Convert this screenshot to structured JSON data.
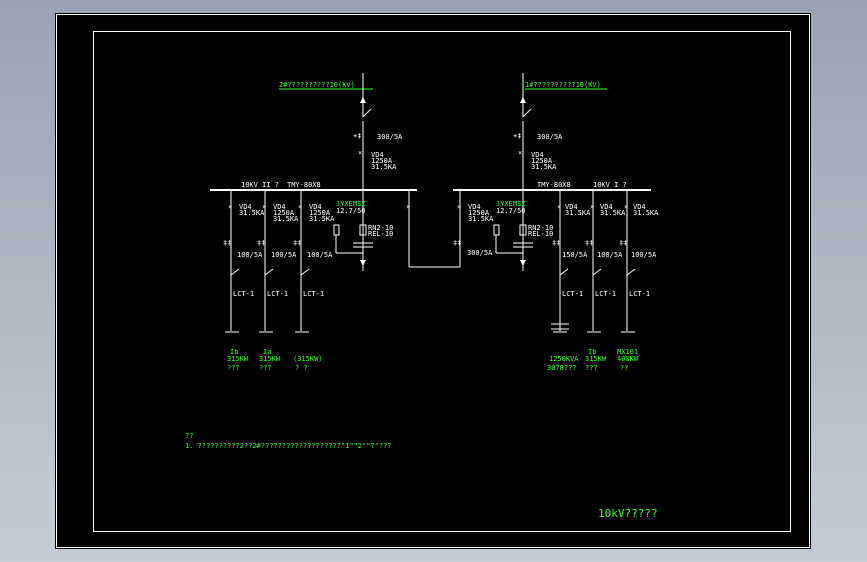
{
  "incomers": {
    "left": {
      "label": "2#??????????10(KV)",
      "ct": "300/5A",
      "breaker": [
        "VD4",
        "1250A",
        "31.5KA"
      ]
    },
    "right": {
      "label": "1#??????????10(KV)",
      "ct": "300/5A",
      "breaker": [
        "VD4",
        "1250A",
        "31.5KA"
      ]
    }
  },
  "buses": {
    "left": {
      "section": "10KV II ?",
      "type": "TMY-80X8"
    },
    "right": {
      "section": "10KV I ?",
      "type": "TMY-80X8"
    }
  },
  "pt_panels": {
    "left": {
      "pt": [
        "JYXEMSZ",
        "12.7/50"
      ],
      "fuse": [
        "RN2-10",
        "REL-10"
      ]
    },
    "right": {
      "pt": [
        "JYXEMSZ",
        "12.7/50"
      ],
      "fuse": [
        "RN2-10",
        "REL-10"
      ]
    }
  },
  "tie": {
    "breaker": [
      "VD4",
      "1250A",
      "31.5KA"
    ],
    "ct": "300/5A"
  },
  "feeders_left": [
    {
      "breaker": [
        "VD4",
        "31.5KA"
      ],
      "ct": "100/5A",
      "relay": "LCT-1",
      "load": [
        "Ib",
        "315KW",
        "???"
      ]
    },
    {
      "breaker": [
        "VD4",
        "1250A",
        "31.5KA"
      ],
      "ct": "100/5A",
      "relay": "LCT-1",
      "load": [
        "Ia",
        "315KW",
        "???"
      ]
    },
    {
      "breaker": [
        "VD4",
        "1250A",
        "31.5KA"
      ],
      "ct": "100/5A",
      "relay": "LCT-1",
      "load": [
        "(315KW)",
        "? ?"
      ]
    }
  ],
  "feeders_right": [
    {
      "breaker": [
        "VD4",
        "31.5KA"
      ],
      "ct": "150/5A",
      "relay": "LCT-1",
      "load": [
        "1250KVA",
        "3078???"
      ]
    },
    {
      "breaker": [
        "VD4",
        "31.5KA"
      ],
      "ct": "100/5A",
      "relay": "LCT-1",
      "load": [
        "Ib",
        "315KW",
        "???"
      ]
    },
    {
      "breaker": [
        "VD4",
        "31.5KA"
      ],
      "ct": "100/5A",
      "relay": "LCT-1",
      "load": [
        "MX101",
        "400KW",
        "??"
      ]
    }
  ],
  "notes": {
    "title": "??",
    "line1": "1. ??????????2??2#???????????????????\"1\"\"2\"\"?\"???"
  },
  "drawing_title": "10kV?????"
}
